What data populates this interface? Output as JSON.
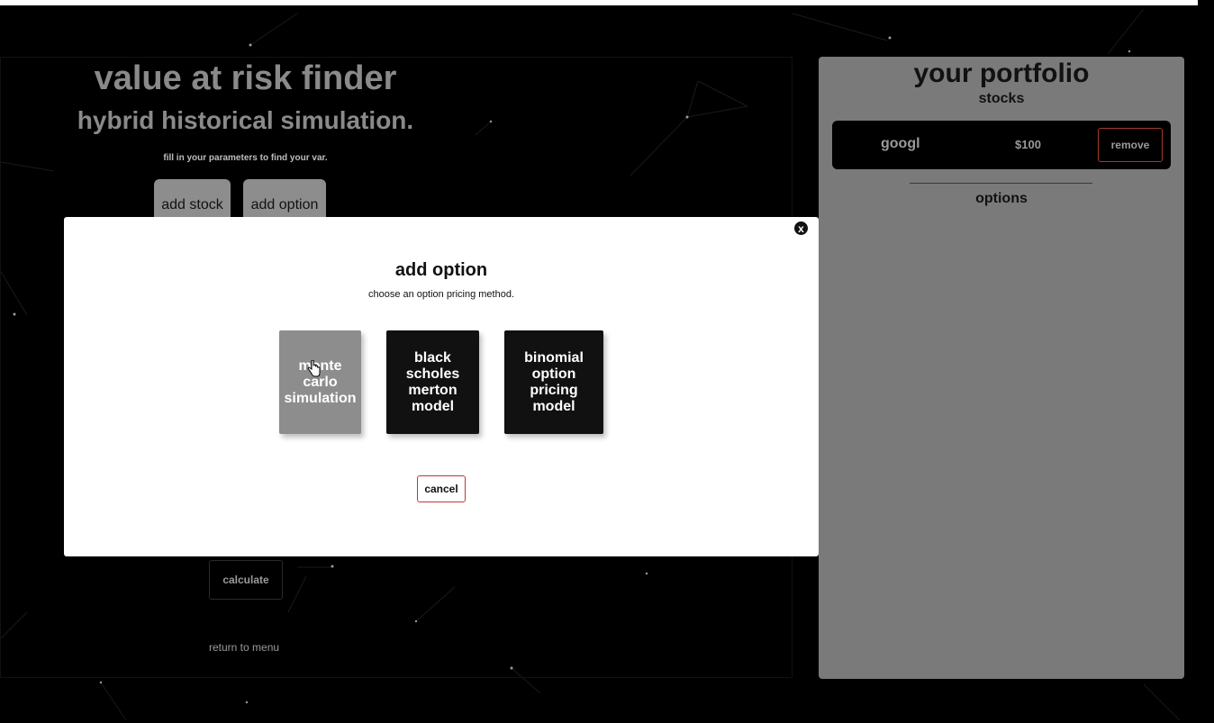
{
  "left_panel": {
    "title": "value at risk finder",
    "subtitle": "hybrid historical simulation.",
    "hint": "fill in your parameters to find your var.",
    "add_stock_label": "add stock",
    "add_option_label": "add option",
    "calculate_label": "calculate",
    "return_label": "return to menu"
  },
  "portfolio": {
    "title": "your portfolio",
    "stocks_heading": "stocks",
    "stocks": [
      {
        "ticker": "googl",
        "value": "$100",
        "remove_label": "remove"
      }
    ],
    "options_heading": "options"
  },
  "modal": {
    "title": "add option",
    "subtitle": "choose an option pricing method.",
    "close_label": "x",
    "methods": [
      {
        "label": "monte carlo simulation",
        "bg": "#8d8d8d"
      },
      {
        "label": "black scholes merton model",
        "bg": "#111111"
      },
      {
        "label": "binomial option pricing model",
        "bg": "#111111"
      }
    ],
    "cancel_label": "cancel"
  },
  "colors": {
    "background": "#000000",
    "panel": "#7a7a7a",
    "accent_red": "#c0392b",
    "muted_text": "#8a8a8a"
  },
  "icons": {
    "close": "close-icon",
    "cursor": "hand-pointer-icon"
  }
}
